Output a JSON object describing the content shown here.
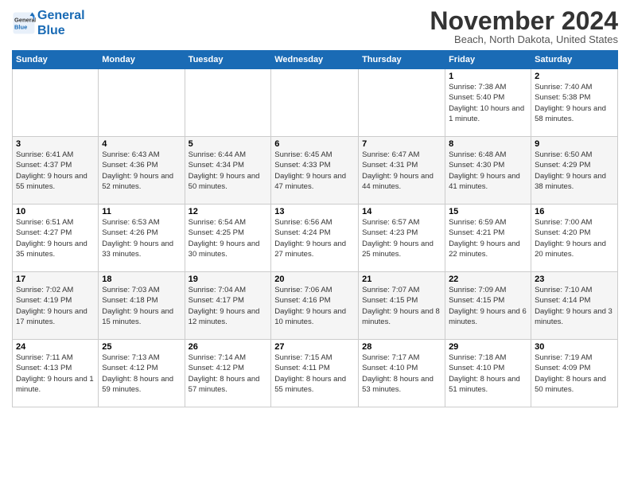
{
  "header": {
    "logo_line1": "General",
    "logo_line2": "Blue",
    "month": "November 2024",
    "location": "Beach, North Dakota, United States"
  },
  "weekdays": [
    "Sunday",
    "Monday",
    "Tuesday",
    "Wednesday",
    "Thursday",
    "Friday",
    "Saturday"
  ],
  "weeks": [
    [
      {
        "day": "",
        "info": ""
      },
      {
        "day": "",
        "info": ""
      },
      {
        "day": "",
        "info": ""
      },
      {
        "day": "",
        "info": ""
      },
      {
        "day": "",
        "info": ""
      },
      {
        "day": "1",
        "info": "Sunrise: 7:38 AM\nSunset: 5:40 PM\nDaylight: 10 hours and 1 minute."
      },
      {
        "day": "2",
        "info": "Sunrise: 7:40 AM\nSunset: 5:38 PM\nDaylight: 9 hours and 58 minutes."
      }
    ],
    [
      {
        "day": "3",
        "info": "Sunrise: 6:41 AM\nSunset: 4:37 PM\nDaylight: 9 hours and 55 minutes."
      },
      {
        "day": "4",
        "info": "Sunrise: 6:43 AM\nSunset: 4:36 PM\nDaylight: 9 hours and 52 minutes."
      },
      {
        "day": "5",
        "info": "Sunrise: 6:44 AM\nSunset: 4:34 PM\nDaylight: 9 hours and 50 minutes."
      },
      {
        "day": "6",
        "info": "Sunrise: 6:45 AM\nSunset: 4:33 PM\nDaylight: 9 hours and 47 minutes."
      },
      {
        "day": "7",
        "info": "Sunrise: 6:47 AM\nSunset: 4:31 PM\nDaylight: 9 hours and 44 minutes."
      },
      {
        "day": "8",
        "info": "Sunrise: 6:48 AM\nSunset: 4:30 PM\nDaylight: 9 hours and 41 minutes."
      },
      {
        "day": "9",
        "info": "Sunrise: 6:50 AM\nSunset: 4:29 PM\nDaylight: 9 hours and 38 minutes."
      }
    ],
    [
      {
        "day": "10",
        "info": "Sunrise: 6:51 AM\nSunset: 4:27 PM\nDaylight: 9 hours and 35 minutes."
      },
      {
        "day": "11",
        "info": "Sunrise: 6:53 AM\nSunset: 4:26 PM\nDaylight: 9 hours and 33 minutes."
      },
      {
        "day": "12",
        "info": "Sunrise: 6:54 AM\nSunset: 4:25 PM\nDaylight: 9 hours and 30 minutes."
      },
      {
        "day": "13",
        "info": "Sunrise: 6:56 AM\nSunset: 4:24 PM\nDaylight: 9 hours and 27 minutes."
      },
      {
        "day": "14",
        "info": "Sunrise: 6:57 AM\nSunset: 4:23 PM\nDaylight: 9 hours and 25 minutes."
      },
      {
        "day": "15",
        "info": "Sunrise: 6:59 AM\nSunset: 4:21 PM\nDaylight: 9 hours and 22 minutes."
      },
      {
        "day": "16",
        "info": "Sunrise: 7:00 AM\nSunset: 4:20 PM\nDaylight: 9 hours and 20 minutes."
      }
    ],
    [
      {
        "day": "17",
        "info": "Sunrise: 7:02 AM\nSunset: 4:19 PM\nDaylight: 9 hours and 17 minutes."
      },
      {
        "day": "18",
        "info": "Sunrise: 7:03 AM\nSunset: 4:18 PM\nDaylight: 9 hours and 15 minutes."
      },
      {
        "day": "19",
        "info": "Sunrise: 7:04 AM\nSunset: 4:17 PM\nDaylight: 9 hours and 12 minutes."
      },
      {
        "day": "20",
        "info": "Sunrise: 7:06 AM\nSunset: 4:16 PM\nDaylight: 9 hours and 10 minutes."
      },
      {
        "day": "21",
        "info": "Sunrise: 7:07 AM\nSunset: 4:15 PM\nDaylight: 9 hours and 8 minutes."
      },
      {
        "day": "22",
        "info": "Sunrise: 7:09 AM\nSunset: 4:15 PM\nDaylight: 9 hours and 6 minutes."
      },
      {
        "day": "23",
        "info": "Sunrise: 7:10 AM\nSunset: 4:14 PM\nDaylight: 9 hours and 3 minutes."
      }
    ],
    [
      {
        "day": "24",
        "info": "Sunrise: 7:11 AM\nSunset: 4:13 PM\nDaylight: 9 hours and 1 minute."
      },
      {
        "day": "25",
        "info": "Sunrise: 7:13 AM\nSunset: 4:12 PM\nDaylight: 8 hours and 59 minutes."
      },
      {
        "day": "26",
        "info": "Sunrise: 7:14 AM\nSunset: 4:12 PM\nDaylight: 8 hours and 57 minutes."
      },
      {
        "day": "27",
        "info": "Sunrise: 7:15 AM\nSunset: 4:11 PM\nDaylight: 8 hours and 55 minutes."
      },
      {
        "day": "28",
        "info": "Sunrise: 7:17 AM\nSunset: 4:10 PM\nDaylight: 8 hours and 53 minutes."
      },
      {
        "day": "29",
        "info": "Sunrise: 7:18 AM\nSunset: 4:10 PM\nDaylight: 8 hours and 51 minutes."
      },
      {
        "day": "30",
        "info": "Sunrise: 7:19 AM\nSunset: 4:09 PM\nDaylight: 8 hours and 50 minutes."
      }
    ]
  ]
}
